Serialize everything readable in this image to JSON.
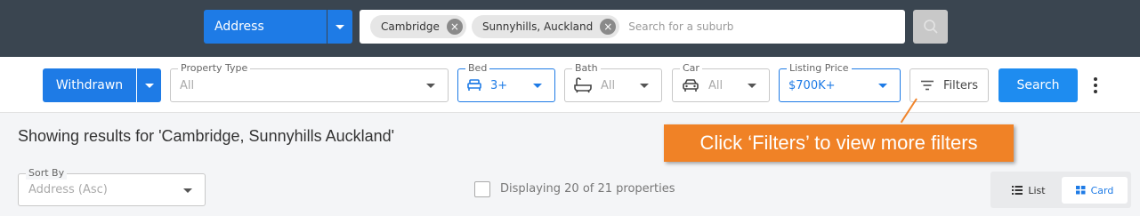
{
  "topbar": {
    "search_type_label": "Address",
    "chips": [
      {
        "label": "Cambridge"
      },
      {
        "label": "Sunnyhills, Auckland"
      }
    ],
    "search_placeholder": "Search for a suburb"
  },
  "filters": {
    "status_label": "Withdrawn",
    "property_type": {
      "legend": "Property Type",
      "value": "All"
    },
    "bed": {
      "legend": "Bed",
      "value": "3+"
    },
    "bath": {
      "legend": "Bath",
      "value": "All"
    },
    "car": {
      "legend": "Car",
      "value": "All"
    },
    "listing_price": {
      "legend": "Listing Price",
      "value": "$700K+"
    },
    "filters_label": "Filters",
    "search_label": "Search"
  },
  "results": {
    "title": "Showing results for 'Cambridge, Sunnyhills Auckland'",
    "sort": {
      "legend": "Sort By",
      "value": "Address (Asc)"
    },
    "display_text": "Displaying 20 of 21 properties",
    "view_list_label": "List",
    "view_card_label": "Card"
  },
  "callout": {
    "text": "Click ‘Filters’ to view more filters"
  },
  "colors": {
    "primary": "#1e7be6",
    "topbar": "#3a4550",
    "callout": "#f08226"
  }
}
